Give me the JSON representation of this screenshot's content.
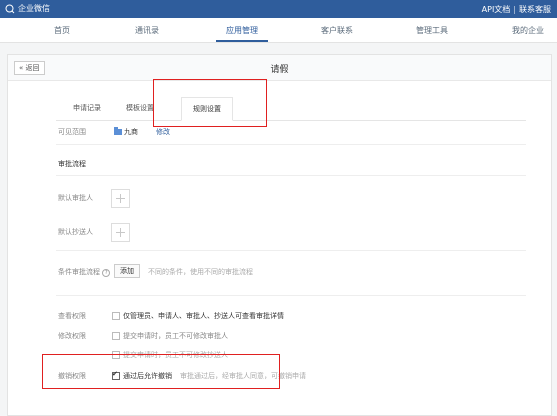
{
  "topbar": {
    "app_name": "企业微信",
    "links": [
      "API文档",
      "联系客服"
    ],
    "separator": "|"
  },
  "nav": {
    "items": [
      "首页",
      "通讯录",
      "应用管理",
      "客户联系",
      "管理工具",
      "我的企业"
    ],
    "active": "应用管理"
  },
  "page": {
    "back_label": "« 返回",
    "title": "请假"
  },
  "tabs": [
    {
      "label": "申请记录"
    },
    {
      "label": "模板设置"
    },
    {
      "label": "规则设置"
    }
  ],
  "form": {
    "visible_range_label": "可见范围",
    "visible_range_value": "九商",
    "visible_range_edit": "修改",
    "approval_flow_label": "审批流程",
    "default_approver_label": "默认审批人",
    "default_cc_label": "默认抄送人",
    "conditional_flow_label": "条件审批流程",
    "conditional_add": "添加",
    "conditional_hint": "不同的条件，使用不同的审批流程",
    "view_perm_label": "查看权限",
    "view_perm_option": "仅管理员、申请人、审批人、抄送人可查看审批详情",
    "edit_perm_label": "修改权限",
    "edit_perm_option1": "提交申请时，员工不可修改审批人",
    "edit_perm_option2": "提交申请时，员工不可修改抄送人",
    "revoke_perm_label": "撤销权限",
    "revoke_perm_option": "通过后允许撤销",
    "revoke_perm_hint": "审批通过后，经审批人同意，可撤销申请"
  },
  "colors": {
    "topbar": "#2f5d9c",
    "highlight": "#e02020"
  }
}
